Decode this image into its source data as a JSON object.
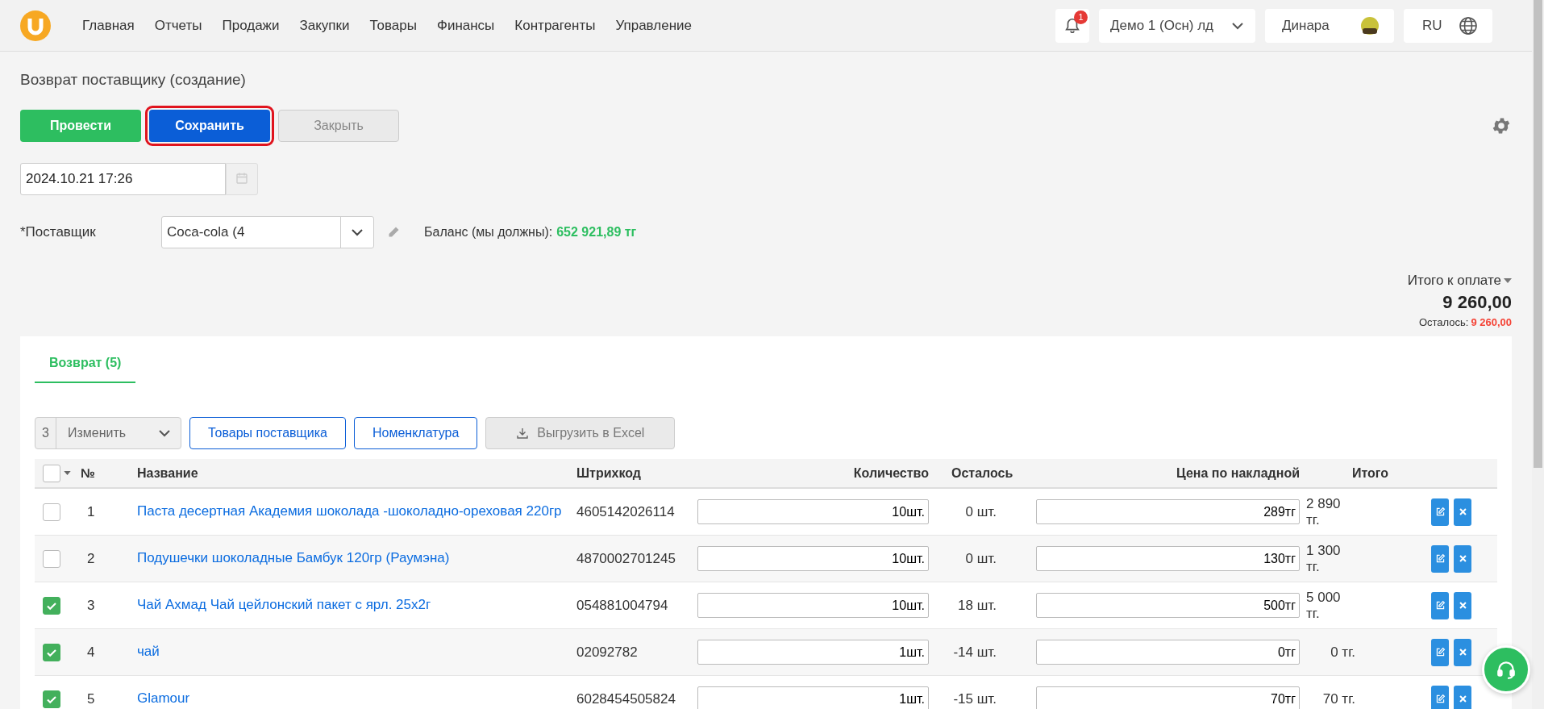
{
  "nav": {
    "items": [
      "Главная",
      "Отчеты",
      "Продажи",
      "Закупки",
      "Товары",
      "Финансы",
      "Контрагенты",
      "Управление"
    ],
    "notifications": "1",
    "organization": "Демо 1 (Осн) лд",
    "user": "Динара",
    "language": "RU"
  },
  "page_title": "Возврат поставщику (создание)",
  "actions": [
    {
      "label": "Провести",
      "kind": "success",
      "focused": false
    },
    {
      "label": "Сохранить",
      "kind": "primary",
      "focused": true
    },
    {
      "label": "Закрыть",
      "kind": "default",
      "focused": false
    }
  ],
  "date": {
    "value": "2024.10.21 17:26"
  },
  "supplier": {
    "label": "*Поставщик",
    "value": "Coca-cola (4",
    "balance_label": "Баланс (мы должны):",
    "balance": "652 921,89 тг"
  },
  "totals": {
    "label": "Итого к оплате",
    "amount": "9 260,00",
    "remaining_label": "Осталось:",
    "remaining": "9 260,00"
  },
  "tabs": [
    {
      "label": "Возврат (5)",
      "selected": true
    }
  ],
  "toolbar": {
    "selected_count": "3",
    "change_label": "Изменить",
    "buttons": [
      {
        "label": "Товары поставщика",
        "kind": "outline"
      },
      {
        "label": "Номенклатура",
        "kind": "outline"
      },
      {
        "label": "Выгрузить в Excel",
        "kind": "export"
      }
    ]
  },
  "table": {
    "select_all": false,
    "columns": [
      "№",
      "Название",
      "Штрихкод",
      "Количество",
      "Осталось",
      "Цена по накладной",
      "Итого"
    ],
    "rows": [
      {
        "checked": false,
        "number": "1",
        "name": "Паста десертная Академия шоколада -шоколадно-ореховая 220гр",
        "barcode": "4605142026114",
        "quantity": "10шт.",
        "remaining": "0 шт.",
        "price": "289тг",
        "total": "2 890 тг."
      },
      {
        "checked": false,
        "number": "2",
        "name": "Подушечки шоколадные Бамбук 120гр (Раумэна)",
        "barcode": "4870002701245",
        "quantity": "10шт.",
        "remaining": "0 шт.",
        "price": "130тг",
        "total": "1 300 тг."
      },
      {
        "checked": true,
        "number": "3",
        "name": "Чай Ахмад Чай цейлонский пакет с ярл. 25х2г",
        "barcode": "054881004794",
        "quantity": "10шт.",
        "remaining": "18 шт.",
        "price": "500тг",
        "total": "5 000 тг."
      },
      {
        "checked": true,
        "number": "4",
        "name": "чай",
        "barcode": "02092782",
        "quantity": "1шт.",
        "remaining": "-14 шт.",
        "price": "0тг",
        "total": "0 тг."
      },
      {
        "checked": true,
        "number": "5",
        "name": "Glamour",
        "barcode": "6028454505824",
        "quantity": "1шт.",
        "remaining": "-15 шт.",
        "price": "70тг",
        "total": "70 тг."
      }
    ]
  }
}
